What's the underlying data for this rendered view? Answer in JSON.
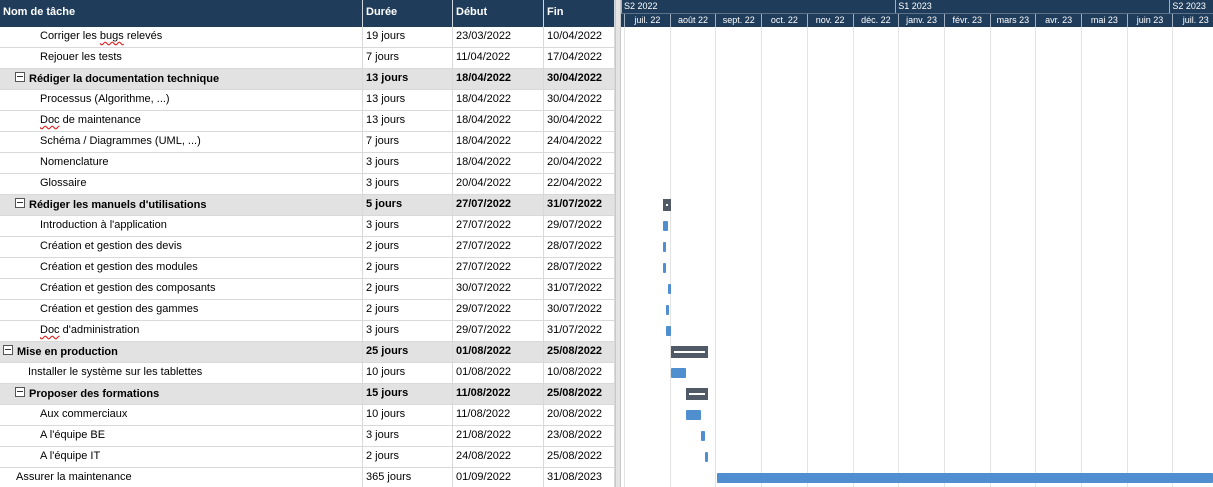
{
  "grid": {
    "headers": {
      "name": "Nom de tâche",
      "duration": "Durée",
      "start": "Début",
      "end": "Fin"
    },
    "rows": [
      {
        "name": "Corriger les ",
        "name_sq": "bugs",
        "name_rest": " relevés",
        "duration": "19 jours",
        "start": "23/03/2022",
        "end": "10/04/2022",
        "indent": 2,
        "summary": false
      },
      {
        "name": "Rejouer les tests",
        "duration": "7 jours",
        "start": "11/04/2022",
        "end": "17/04/2022",
        "indent": 2,
        "summary": false
      },
      {
        "name": "Rédiger la documentation technique",
        "duration": "13 jours",
        "start": "18/04/2022",
        "end": "30/04/2022",
        "indent": 1,
        "summary": true
      },
      {
        "name": "Processus (Algorithme, ...)",
        "duration": "13 jours",
        "start": "18/04/2022",
        "end": "30/04/2022",
        "indent": 2,
        "summary": false
      },
      {
        "name": "",
        "name_sq": "Doc",
        "name_rest": " de maintenance",
        "duration": "13 jours",
        "start": "18/04/2022",
        "end": "30/04/2022",
        "indent": 2,
        "summary": false
      },
      {
        "name": "Schéma / Diagrammes (UML, ...)",
        "duration": "7 jours",
        "start": "18/04/2022",
        "end": "24/04/2022",
        "indent": 2,
        "summary": false
      },
      {
        "name": "Nomenclature",
        "duration": "3 jours",
        "start": "18/04/2022",
        "end": "20/04/2022",
        "indent": 2,
        "summary": false
      },
      {
        "name": "Glossaire",
        "duration": "3 jours",
        "start": "20/04/2022",
        "end": "22/04/2022",
        "indent": 2,
        "summary": false
      },
      {
        "name": "Rédiger les manuels d'utilisations",
        "duration": "5 jours",
        "start": "27/07/2022",
        "end": "31/07/2022",
        "indent": 1,
        "summary": true
      },
      {
        "name": "Introduction à l'application",
        "duration": "3 jours",
        "start": "27/07/2022",
        "end": "29/07/2022",
        "indent": 2,
        "summary": false
      },
      {
        "name": "Création et gestion des devis",
        "duration": "2 jours",
        "start": "27/07/2022",
        "end": "28/07/2022",
        "indent": 2,
        "summary": false
      },
      {
        "name": "Création et gestion des modules",
        "duration": "2 jours",
        "start": "27/07/2022",
        "end": "28/07/2022",
        "indent": 2,
        "summary": false
      },
      {
        "name": "Création et gestion des composants",
        "duration": "2 jours",
        "start": "30/07/2022",
        "end": "31/07/2022",
        "indent": 2,
        "summary": false
      },
      {
        "name": "Création et gestion des gammes",
        "duration": "2 jours",
        "start": "29/07/2022",
        "end": "30/07/2022",
        "indent": 2,
        "summary": false
      },
      {
        "name": "",
        "name_sq": "Doc",
        "name_rest": " d'administration",
        "duration": "3 jours",
        "start": "29/07/2022",
        "end": "31/07/2022",
        "indent": 2,
        "summary": false
      },
      {
        "name": "Mise en production",
        "duration": "25 jours",
        "start": "01/08/2022",
        "end": "25/08/2022",
        "indent": 0,
        "summary": true
      },
      {
        "name": "Installer le système sur les tablettes",
        "duration": "10 jours",
        "start": "01/08/2022",
        "end": "10/08/2022",
        "indent": 1,
        "summary": false
      },
      {
        "name": "Proposer des formations",
        "duration": "15 jours",
        "start": "11/08/2022",
        "end": "25/08/2022",
        "indent": 1,
        "summary": true
      },
      {
        "name": "Aux commerciaux",
        "duration": "10 jours",
        "start": "11/08/2022",
        "end": "20/08/2022",
        "indent": 2,
        "summary": false
      },
      {
        "name": "A l'équipe BE",
        "duration": "3 jours",
        "start": "21/08/2022",
        "end": "23/08/2022",
        "indent": 2,
        "summary": false
      },
      {
        "name": "A l'équipe IT",
        "duration": "2 jours",
        "start": "24/08/2022",
        "end": "25/08/2022",
        "indent": 2,
        "summary": false
      },
      {
        "name": "Assurer la maintenance",
        "duration": "365 jours",
        "start": "01/09/2022",
        "end": "31/08/2023",
        "indent": 0,
        "summary": false
      }
    ]
  },
  "timeline": {
    "periods": [
      "S2 2022",
      "S1 2023",
      "S2 2023"
    ],
    "months": [
      "juil. 22",
      "août 22",
      "sept. 22",
      "oct. 22",
      "nov. 22",
      "déc. 22",
      "janv. 23",
      "févr. 23",
      "mars 23",
      "avr. 23",
      "mai 23",
      "juin 23",
      "juil. 23"
    ],
    "visible_from": "2022-07-01",
    "colors": {
      "task": "#4f8fd0",
      "summary": "#505a66",
      "header": "#1f3c5a"
    }
  }
}
